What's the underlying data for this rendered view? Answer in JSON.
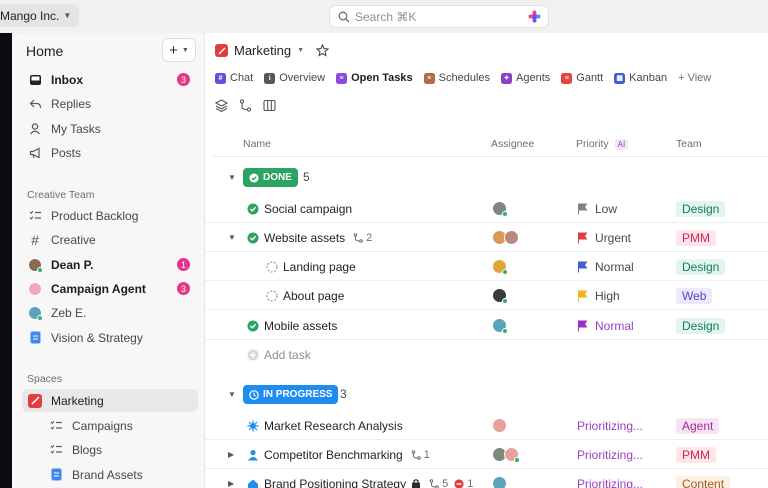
{
  "app": {
    "workspace": "Mango Inc.",
    "search_placeholder": "Search ⌘K"
  },
  "sidebar": {
    "title": "Home",
    "plus": "+",
    "main_items": [
      {
        "label": "Inbox",
        "icon": "inbox-icon",
        "badge": "3"
      },
      {
        "label": "Replies",
        "icon": "reply-icon"
      },
      {
        "label": "My Tasks",
        "icon": "user-icon"
      },
      {
        "label": "Posts",
        "icon": "megaphone-icon"
      }
    ],
    "section_team": "Creative Team",
    "team_items": [
      {
        "label": "Product Backlog",
        "icon": "list-icon"
      },
      {
        "label": "Creative",
        "icon": "hash-icon"
      },
      {
        "label": "Dean P.",
        "icon": "avatar",
        "badge": "1"
      },
      {
        "label": "Campaign Agent",
        "icon": "avatar",
        "badge": "3"
      },
      {
        "label": "Zeb E.",
        "icon": "avatar"
      },
      {
        "label": "Vision & Strategy",
        "icon": "doc-icon"
      }
    ],
    "section_spaces": "Spaces",
    "space_items": [
      {
        "label": "Marketing",
        "icon": "space-icon"
      },
      {
        "label": "Campaigns",
        "icon": "list-icon"
      },
      {
        "label": "Blogs",
        "icon": "list-icon"
      },
      {
        "label": "Brand Assets",
        "icon": "doc-icon"
      }
    ]
  },
  "header": {
    "space": "Marketing"
  },
  "tabs": [
    {
      "label": "Chat",
      "color": "#6e4bd8",
      "glyph": "#"
    },
    {
      "label": "Overview",
      "color": "#55575c",
      "glyph": "i"
    },
    {
      "label": "Open Tasks",
      "color": "#8b4bd8",
      "glyph": "≡"
    },
    {
      "label": "Schedules",
      "color": "#b46b4a",
      "glyph": "≡"
    },
    {
      "label": "Agents",
      "color": "#8b3fc9",
      "glyph": "✦"
    },
    {
      "label": "Gantt",
      "color": "#e1493d",
      "glyph": "≡"
    },
    {
      "label": "Kanban",
      "color": "#3f5ed6",
      "glyph": "▦"
    },
    {
      "label": "+ View",
      "color": "",
      "glyph": ""
    }
  ],
  "columns": {
    "name": "Name",
    "assignee": "Assignee",
    "priority": "Priority",
    "ai": "AI",
    "team": "Team"
  },
  "groups": [
    {
      "status": "DONE",
      "count": "5",
      "color": "#2aa363"
    },
    {
      "status": "IN PROGRESS",
      "count": "3",
      "color": "#1f8cf0"
    }
  ],
  "tasks": {
    "t1": {
      "name": "Social campaign",
      "priority": "Low",
      "team": "Design"
    },
    "t2": {
      "name": "Website assets",
      "subtasks": "2",
      "priority": "Urgent",
      "team": "PMM"
    },
    "t3": {
      "name": "Landing page",
      "priority": "Normal",
      "team": "Design"
    },
    "t4": {
      "name": "About page",
      "priority": "High",
      "team": "Web"
    },
    "t5": {
      "name": "Mobile assets",
      "priority": "Normal",
      "team": "Design"
    },
    "add": "Add task",
    "t6": {
      "name": "Market Research Analysis",
      "priority": "Prioritizing...",
      "team": "Agent"
    },
    "t7": {
      "name": "Competitor Benchmarking",
      "subtasks": "1",
      "priority": "Prioritizing...",
      "team": "PMM"
    },
    "t8": {
      "name": "Brand Positioning Strategy",
      "subtasks": "5",
      "blockers": "1",
      "priority": "Prioritizing...",
      "team": "Content"
    }
  }
}
